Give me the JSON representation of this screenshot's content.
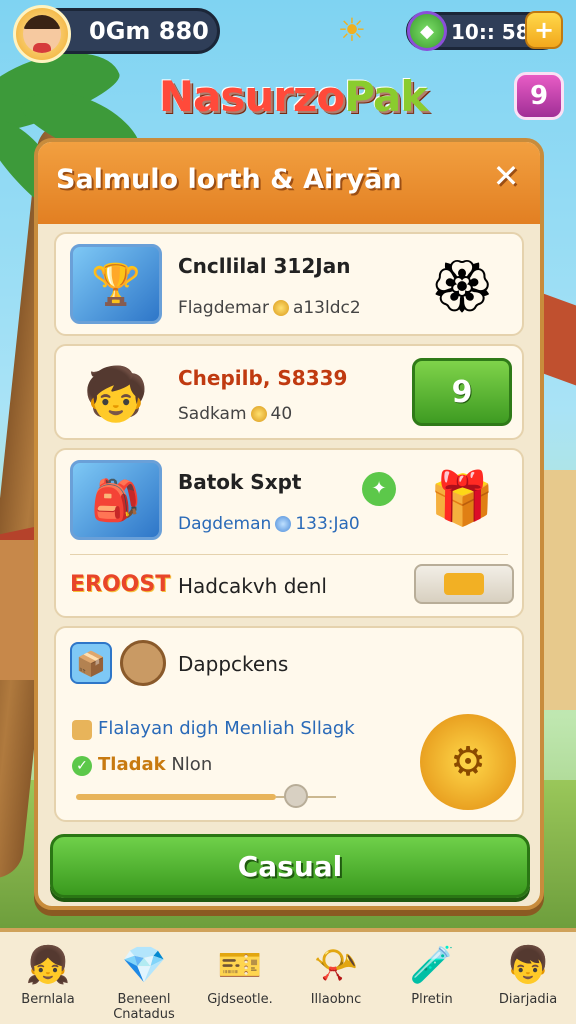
{
  "top_bar": {
    "profile_text": "0Gm 880",
    "currency_text": "10:: 580",
    "plus_label": "+",
    "sun_icon": "sun-icon",
    "gem_icon": "gem-icon"
  },
  "title": {
    "part1": "Nasurzo",
    "part2": "Pak"
  },
  "chat_label": "9",
  "panel": {
    "title": "Salmulo lorth & Airyān",
    "close_label": "✕",
    "rows": [
      {
        "title": "Cncllilal 312Jan",
        "sub_label": "Flagdemar",
        "sub_value": "a13ldc2"
      },
      {
        "title": "Chepilb, S8339",
        "sub_label": "Sadkam",
        "sub_value": "40",
        "button_label": "9"
      },
      {
        "title": "Batok Sxpt",
        "sub_label": "Dagdeman",
        "sub_value": "133:Ja0"
      },
      {
        "title": "Hadcakvh denl",
        "badge": "EROOST"
      },
      {
        "title": "Dappckens",
        "line1": "Flalayan digh Menliah Sllagk",
        "line2": "Tladak",
        "line2b": "Nlon"
      }
    ],
    "casual_label": "Casual"
  },
  "bottom_nav": [
    {
      "label": "Bernlala",
      "icon": "avatar-girl-icon"
    },
    {
      "label": "Beneenl Cnatadus",
      "icon": "crystal-icon"
    },
    {
      "label": "Gjdseotle.",
      "icon": "ticket-icon"
    },
    {
      "label": "Illaobnc",
      "icon": "horn-icon"
    },
    {
      "label": "Plretin",
      "icon": "potion-icon"
    },
    {
      "label": "Diarjadia",
      "icon": "avatar-boy-icon"
    }
  ],
  "colors": {
    "accent": "#e27f22",
    "green": "#3e9b22",
    "panel_bg": "#f3e8cf"
  }
}
